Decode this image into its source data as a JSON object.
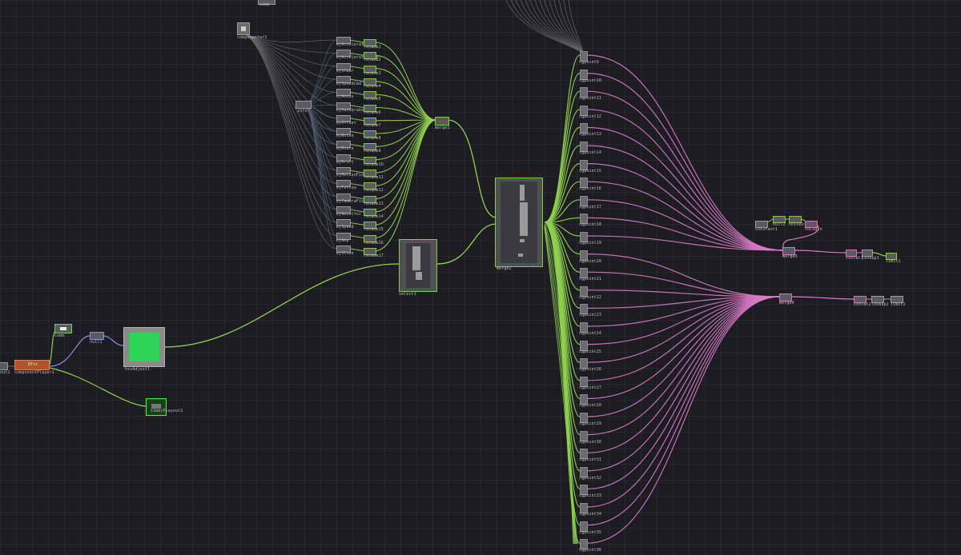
{
  "app": {
    "name": "TouchDesigner network editor"
  },
  "colors": {
    "background": "#1c1c22",
    "green_wire": "#8fd14f",
    "pink_wire": "#d77cc6",
    "blue_wire": "#8a8fe0",
    "gray_wire": "#6a6a6a"
  },
  "top_node": {
    "label": "comm"
  },
  "left_nodes": {
    "out_stub": "out1",
    "player_node": "componentPlayer1",
    "player_badge": "DTvr",
    "small_top": "comm",
    "blue_node": "null1",
    "green_preview": "hsvAdjust1",
    "output_node": "timerPlayout1"
  },
  "upper_cluster": {
    "source": "componentar1",
    "side": "info",
    "merge": "merge1",
    "rows": [
      {
        "left": "ejAccelerate",
        "right": "rename1"
      },
      {
        "left": "ejAccelerateBrake",
        "right": "rename2"
      },
      {
        "left": "ejSteer",
        "right": "rename3"
      },
      {
        "left": "ejSpeedCmd",
        "right": "rename4"
      },
      {
        "left": "ejAmous",
        "right": "rename5"
      },
      {
        "left": "ejHandbrake",
        "right": "rename6"
      },
      {
        "left": "ejOffset",
        "right": "rename7"
      },
      {
        "left": "ejNoise",
        "right": "rename8"
      },
      {
        "left": "ejRoute",
        "right": "rename9"
      },
      {
        "left": "ejDrift",
        "right": "rename10"
      },
      {
        "left": "ejMotionFix",
        "right": "rename11"
      },
      {
        "left": "ejFollow",
        "right": "rename12"
      },
      {
        "left": "ejCameraFix",
        "right": "rename13"
      },
      {
        "left": "ejAmoutfor",
        "right": "rename14"
      },
      {
        "left": "ejSpeed",
        "right": "rename15"
      },
      {
        "left": "ejAmp",
        "right": "rename16"
      },
      {
        "left": "ejSlide",
        "right": "rename17"
      }
    ]
  },
  "mid_nodes": {
    "select": "select1",
    "merge2": "merge2"
  },
  "right_column": {
    "items": [
      "cgpoint9",
      "cgpoint10",
      "cgpoint11",
      "cgpoint12",
      "cgpoint13",
      "cgpoint14",
      "cgpoint15",
      "cgpoint16",
      "cgpoint17",
      "cgpoint18",
      "cgpoint19",
      "cgpoint20",
      "cgpoint21",
      "cgpoint22",
      "cgpoint23",
      "cgpoint24",
      "cgpoint25",
      "cgpoint26",
      "cgpoint27",
      "cgpoint28",
      "cgpoint29",
      "cgpoint30",
      "cgpoint31",
      "cgpoint32",
      "cgpoint33",
      "cgpoint34",
      "cgpoint35",
      "cgpoint36"
    ]
  },
  "right_upper": {
    "a": "constant1",
    "b": "null2",
    "c": "noise1",
    "merge": "merge3",
    "chain": [
      "concat1",
      "lookup1",
      "limit1"
    ]
  },
  "right_lower": {
    "merge": "merge4",
    "chain": [
      "concat2",
      "lookup2",
      "limit2"
    ]
  }
}
